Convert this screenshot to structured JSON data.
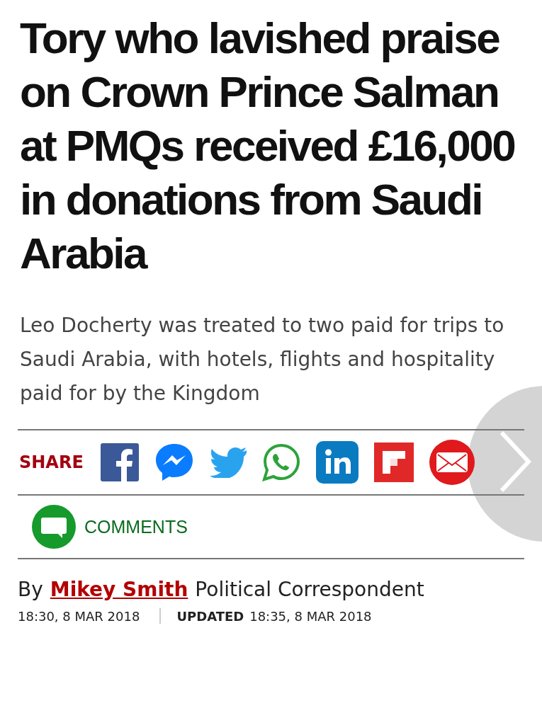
{
  "headline": "Tory who lavished praise on Crown Prince Salman at PMQs received £16,000 in donations from Saudi Arabia",
  "standfirst": "Leo Docherty was treated to two paid for trips to Saudi Arabia, with hotels, flights and hospitality paid for by the Kingdom",
  "share": {
    "label": "SHARE",
    "buttons": [
      {
        "kind": "facebook"
      },
      {
        "kind": "messenger"
      },
      {
        "kind": "twitter"
      },
      {
        "kind": "whatsapp"
      },
      {
        "kind": "linkedin"
      },
      {
        "kind": "flipboard"
      },
      {
        "kind": "email"
      }
    ]
  },
  "comments": {
    "label": "COMMENTS"
  },
  "byline": {
    "prefix": "By",
    "author": "Mikey Smith",
    "role": "Political Correspondent"
  },
  "published": "18:30, 8 MAR 2018",
  "updated": {
    "label": "UPDATED",
    "time": "18:35, 8 MAR 2018"
  }
}
